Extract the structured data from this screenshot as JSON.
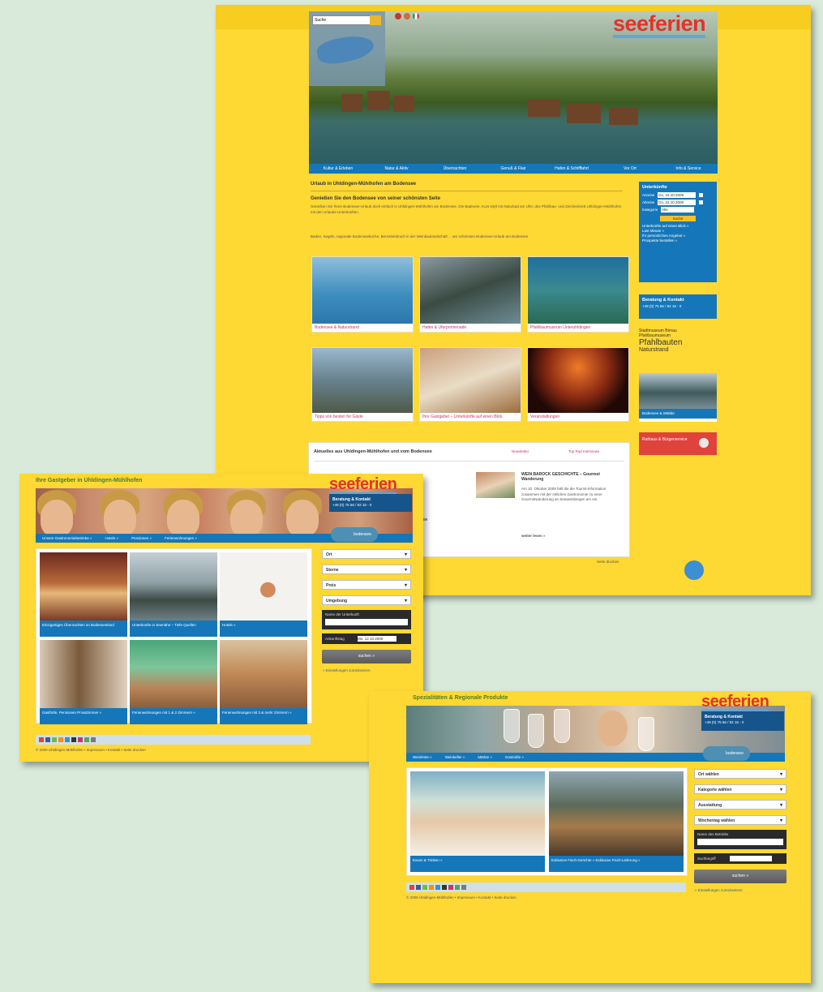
{
  "shot1": {
    "search_placeholder": "Suche",
    "logo": "seeferien",
    "nav": [
      "Kultur & Erleben",
      "Natur & Aktiv",
      "Übernachten",
      "Genuß & Flair",
      "Hafen & Schifffahrt",
      "Vor Ort",
      "Info & Service"
    ],
    "title": "Urlaub in Uhldingen-Mühlhofen am Bodensee",
    "subtitle": "Genießen Sie den Bodensee von seiner schönsten Seite",
    "para1": "Genießen Sie Ihren Bodensee-Urlaub doch einfach in Uhldingen-Mühlhofen am Bodensee. Die Badeorte, Kurs-Idyll mit Naturbad am Ufer, des Pfahlbau- und Zeichenbrett Uhldingen-Mühlhofen mit den Urlaubs-Unterkünften.",
    "para2": "Baden, Segeln, regionale Bodenseeküche, Bernsteinbruch in der Weinbaulandschaft ... am schönsten Bodensee-Urlaub am Bodensee",
    "tiles": [
      "Bodensee & Naturstrand",
      "Hafen & Uferpromenade",
      "Pfahlbaumuseum Unteruhldingen",
      "Tipps von besten für Gäste",
      "Ihre Gastgeber – Unterkünfte auf einen Blick",
      "Veranstaltungen"
    ],
    "booking": {
      "title": "Unterkünfte",
      "arrival_label": "Anreise",
      "arrival_value": "Do, 15.10.2009",
      "departure_label": "Abreise",
      "departure_value": "Do, 22.10.2009",
      "category_label": "Kategorie",
      "category_value": "Alle",
      "button": "Suche",
      "links": [
        "Unterkünfte auf einen Blick »",
        "Last Minute »",
        "Ihr persönliches Angebot »",
        "Prospekte bestellen »"
      ]
    },
    "contact": {
      "title": "Beratung & Kontakt",
      "phone": "+49 (0) 75 56 / 92 16 - 0"
    },
    "promo": [
      "Stadtmuseum Birnau",
      "Pfahlbaumuseum",
      "Pfahlbauten",
      "Naturstrand"
    ],
    "promo_caption": "Bodensee & Wälder",
    "red_button": "Rathaus & Bürgerservice",
    "news": {
      "title": "Aktuelles aus Uhldingen-Mühlhofen und vom Bodensee",
      "link1": "Newsletter",
      "link2": "Top Rad Interviews",
      "item_title": "WEIN BAROCK GESCHICHTE – Gourmet Wanderung",
      "item_text": "Am 10. Oktober 2009 hält die die Tourist-Information zusammen mit der örtlichen Gastronomie zu einer Gourmetwanderung an Seeweinbergen am ein.",
      "more": "weiter lesen »",
      "left_date": "10. Oktober 2009",
      "footer": "Seite drucken"
    }
  },
  "shot2": {
    "title": "Ihre Gastgeber in Uhldingen-Mühlhofen",
    "logo": "seeferien",
    "contact_title": "Beratung & Kontakt",
    "contact_phone": "+49 (0) 75 56 / 92 16 - 0",
    "nav": [
      "Unsere Gastronomiebetriebe »",
      "Hotels »",
      "Pensionen »",
      "Ferienwohnungen »"
    ],
    "badge": "bodensee",
    "tiles": [
      "Einzigartiges Übernachten im Bodenseeland",
      "Unterkünfte in Seenähe – Tiefe Quellen",
      "Hotels »",
      "Gasthöfe, Pensionen Privatzimmer »",
      "Ferienwohnungen mit 1 & 2 Zimmern »",
      "Ferienwohnungen mit 3 & mehr Zimmern »"
    ],
    "filters": [
      "Ort",
      "Sterne",
      "Preis",
      "Umgebung"
    ],
    "name_label": "Name der Unterkunft",
    "date_label": "Ankunftstag",
    "date_value": "Mo, 12.10.2009",
    "search_button": "suchen »",
    "reset_link": "» Einstellungen zurücksetzen",
    "footer": "© 2009 Uhldingen-Mühlhofen • Impressum • Kontakt • Seite drucken"
  },
  "shot3": {
    "title": "Spezialitäten & Regionale Produkte",
    "logo": "seeferien",
    "contact_title": "Beratung & Kontakt",
    "contact_phone": "+49 (0) 75 56 / 92 16 - 0",
    "nav": [
      "Weinfeste »",
      "Weinkeller »",
      "Märkte »",
      "Gastrolife »"
    ],
    "badge": "bodensee",
    "tiles": [
      "Essen & Trinken »",
      "Exklusive Fisch-Gerichte » Exklusive Fisch-Lieferung »"
    ],
    "filters": [
      "Ort wählen",
      "Kategorie wählen",
      "Ausstattung",
      "Wochentag wählen"
    ],
    "name_label": "Name des Betriebs",
    "date_label": "Suchbegriff",
    "search_button": "suchen »",
    "reset_link": "» Einstellungen zurücksetzen",
    "footer": "© 2009 Uhldingen-Mühlhofen • Impressum • Kontakt • Seite drucken"
  },
  "colors": {
    "page_bg": "#d9eadb",
    "yellow": "#fed833",
    "blue": "#1577b9",
    "red": "#e3322d",
    "pink": "#c9346a"
  }
}
